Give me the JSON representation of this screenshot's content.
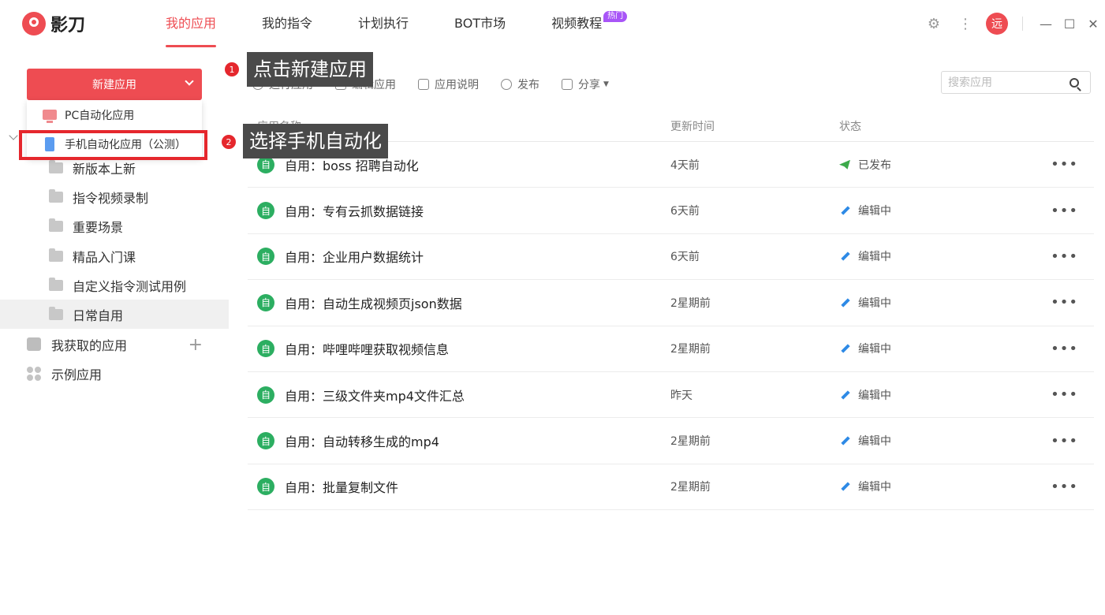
{
  "app": {
    "name": "影刀"
  },
  "nav": {
    "tabs": [
      {
        "label": "我的应用"
      },
      {
        "label": "我的指令"
      },
      {
        "label": "计划执行"
      },
      {
        "label": "BOT市场"
      },
      {
        "label": "视频教程",
        "badge": "热门"
      }
    ],
    "active_index": 0
  },
  "user": {
    "avatar_text": "远"
  },
  "sidebar": {
    "new_button_label": "新建应用",
    "dropdown": [
      {
        "label": "PC自动化应用",
        "icon": "pc-icon"
      },
      {
        "label": "手机自动化应用（公测）",
        "icon": "phone-icon"
      }
    ],
    "folders": [
      {
        "label": "新版本上新"
      },
      {
        "label": "指令视频录制"
      },
      {
        "label": "重要场景"
      },
      {
        "label": "精品入门课"
      },
      {
        "label": "自定义指令测试用例"
      },
      {
        "label": "日常自用"
      }
    ],
    "selected_folder": "日常自用",
    "acquired_label": "我获取的应用",
    "examples_label": "示例应用"
  },
  "callouts": [
    {
      "number": "1",
      "text": "点击新建应用"
    },
    {
      "number": "2",
      "text": "选择手机自动化"
    }
  ],
  "toolbar": {
    "run": "运行应用",
    "edit": "编辑应用",
    "doc": "应用说明",
    "publish": "发布",
    "share": "分享"
  },
  "search": {
    "placeholder": "搜索应用",
    "value": ""
  },
  "table": {
    "columns": {
      "name": "应用名称",
      "time": "更新时间",
      "status": "状态"
    },
    "badge_text": "自",
    "rows": [
      {
        "name": "自用：boss 招聘自动化",
        "time": "4天前",
        "status": "已发布",
        "status_type": "published"
      },
      {
        "name": "自用：专有云抓数据链接",
        "time": "6天前",
        "status": "编辑中",
        "status_type": "editing"
      },
      {
        "name": "自用：企业用户数据统计",
        "time": "6天前",
        "status": "编辑中",
        "status_type": "editing"
      },
      {
        "name": "自用：自动生成视频页json数据",
        "time": "2星期前",
        "status": "编辑中",
        "status_type": "editing"
      },
      {
        "name": "自用：哔哩哔哩获取视频信息",
        "time": "2星期前",
        "status": "编辑中",
        "status_type": "editing"
      },
      {
        "name": "自用：三级文件夹mp4文件汇总",
        "time": "昨天",
        "status": "编辑中",
        "status_type": "editing"
      },
      {
        "name": "自用：自动转移生成的mp4",
        "time": "2星期前",
        "status": "编辑中",
        "status_type": "editing"
      },
      {
        "name": "自用：批量复制文件",
        "time": "2星期前",
        "status": "编辑中",
        "status_type": "editing"
      }
    ]
  },
  "colors": {
    "accent": "#ee4c52",
    "callout_bg": "#4a4a4a",
    "highlight_box": "#e5272d",
    "app_badge": "#2cae61",
    "hot_badge": "#a855f7"
  }
}
